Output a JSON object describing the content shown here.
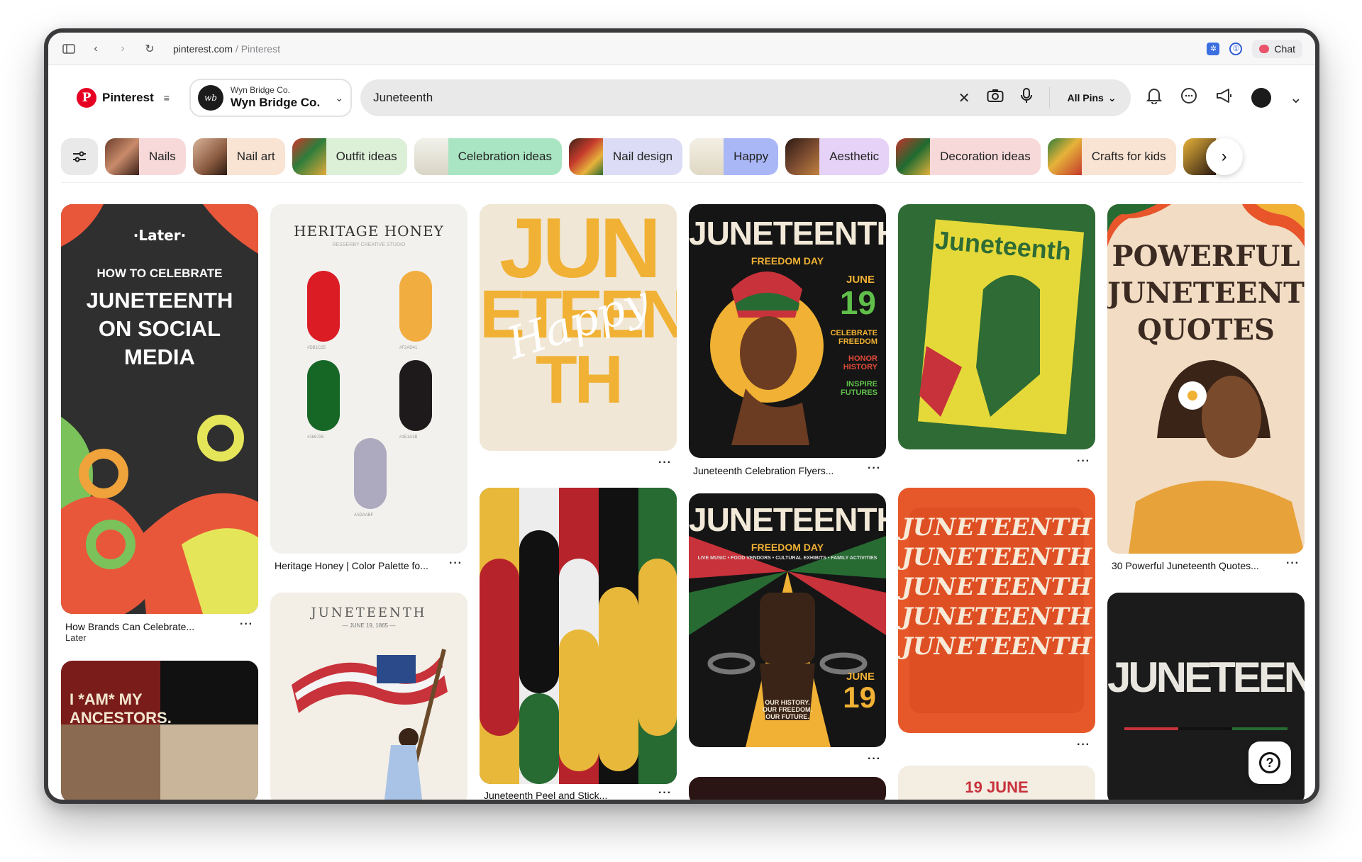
{
  "browser": {
    "url_domain": "pinterest.com",
    "url_separator": " / ",
    "url_title": "Pinterest",
    "chat_label": "Chat"
  },
  "header": {
    "brand_name": "Pinterest",
    "account_small": "Wyn Bridge Co.",
    "account_big": "Wyn Bridge Co.",
    "search_query": "Juneteenth",
    "scope_label": "All Pins"
  },
  "chips": [
    {
      "label": "Nails",
      "bg": "#f7d9d9"
    },
    {
      "label": "Nail art",
      "bg": "#f9e3d3"
    },
    {
      "label": "Outfit ideas",
      "bg": "#dcefd7"
    },
    {
      "label": "Celebration ideas",
      "bg": "#a9e5c2"
    },
    {
      "label": "Nail design",
      "bg": "#dcdcf6"
    },
    {
      "label": "Happy",
      "bg": "#a9b7f7"
    },
    {
      "label": "Aesthetic",
      "bg": "#e6d2f7"
    },
    {
      "label": "Decoration ideas",
      "bg": "#f7d9d9"
    },
    {
      "label": "Crafts for kids",
      "bg": "#f9e3d3"
    }
  ],
  "pins": {
    "p1": {
      "caption": "How Brands Can Celebrate...",
      "sub": "Later",
      "logo": "·Later·",
      "line1": "HOW TO CELEBRATE",
      "line2": "JUNETEENTH",
      "line3": "ON SOCIAL",
      "line4": "MEDIA"
    },
    "p2": {
      "caption": "Heritage Honey | Color Palette fo...",
      "title": "HERITAGE HONEY",
      "subtitle": "RESSERBY CREATIVE STUDIO",
      "swatches": [
        "#DB1C25",
        "#F2AD41",
        "#166726",
        "#1E1A1B",
        "#ADAABF"
      ]
    },
    "p3": {
      "line1": "JUN",
      "line2": "ETEEN",
      "line3": "TH",
      "script": "Happy"
    },
    "p4": {
      "caption": "Juneteenth Celebration Flyers...",
      "title": "JUNETEENTH",
      "band": "FREEDOM DAY",
      "month": "JUNE",
      "day": "19",
      "celebrate": "CELEBRATE FREEDOM",
      "honor": "HONOR HISTORY",
      "inspire": "INSPIRE FUTURES"
    },
    "p5": {
      "text": "Juneteenth"
    },
    "p6": {
      "caption": "30 Powerful Juneteenth Quotes...",
      "line1": "POWERFUL",
      "line2": "JUNETEENTH",
      "line3": "QUOTES"
    },
    "p7": {
      "title": "JUNETEENTH",
      "date": "— JUNE 19, 1865 —"
    },
    "p8": {
      "caption": "Juneteenth Peel and Stick..."
    },
    "p9": {
      "title": "JUNETEENTH",
      "band": "FREEDOM DAY",
      "sub": "LIVE MUSIC • FOOD VENDORS • CULTURAL EXHIBITS • FAMILY ACTIVITIES",
      "month": "JUNE",
      "day": "19",
      "footer": "OUR HISTORY. OUR FREEDOM. OUR FUTURE."
    },
    "p10": {
      "text": "JUNETEENTH"
    },
    "p11": {
      "text": "JUNETEENTH"
    },
    "p12": {
      "text": "I *AM* MY ANCESTORS."
    },
    "p13": {
      "text": "19 JUNE"
    }
  }
}
